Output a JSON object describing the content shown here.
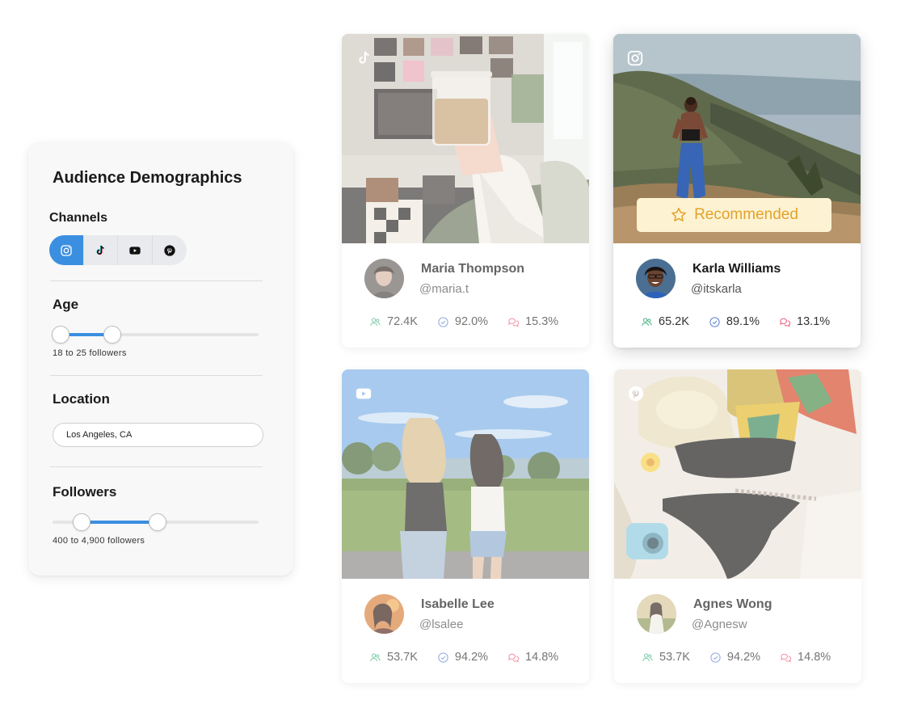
{
  "filters": {
    "title": "Audience Demographics",
    "channels": {
      "label": "Channels",
      "items": [
        {
          "icon": "instagram-icon",
          "active": true
        },
        {
          "icon": "tiktok-icon",
          "active": false
        },
        {
          "icon": "youtube-icon",
          "active": false
        },
        {
          "icon": "pinterest-icon",
          "active": false
        }
      ]
    },
    "age": {
      "label": "Age",
      "caption": "18 to 25 followers",
      "range_fraction": [
        0.04,
        0.29
      ]
    },
    "location": {
      "label": "Location",
      "value": "Los Angeles, CA"
    },
    "followers": {
      "label": "Followers",
      "caption": "400 to 4,900 followers",
      "range_fraction": [
        0.14,
        0.51
      ]
    },
    "accent_color": "#3b8fe0"
  },
  "creators": [
    {
      "name": "Maria Thompson",
      "handle": "@maria.t",
      "platform": "tiktok-icon",
      "followers": "72.4K",
      "authenticity": "92.0%",
      "engagement": "15.3%",
      "recommended": false
    },
    {
      "name": "Karla Williams",
      "handle": "@itskarla",
      "platform": "instagram-icon",
      "followers": "65.2K",
      "authenticity": "89.1%",
      "engagement": "13.1%",
      "recommended": true,
      "badge_label": "Recommended"
    },
    {
      "name": "Isabelle Lee",
      "handle": "@lsalee",
      "platform": "youtube-icon",
      "followers": "53.7K",
      "authenticity": "94.2%",
      "engagement": "14.8%",
      "recommended": false
    },
    {
      "name": "Agnes Wong",
      "handle": "@Agnesw",
      "platform": "pinterest-icon",
      "followers": "53.7K",
      "authenticity": "94.2%",
      "engagement": "14.8%",
      "recommended": false
    }
  ],
  "stat_icons": {
    "followers": "users-icon",
    "authenticity": "check-circle-icon",
    "engagement": "chat-bubbles-icon"
  },
  "colors": {
    "followers_icon": "#3fb37f",
    "authenticity_icon": "#5b7fd1",
    "engagement_icon": "#ef5a7a",
    "badge_text": "#e3a22b",
    "badge_bg": "#fdf3d3"
  }
}
